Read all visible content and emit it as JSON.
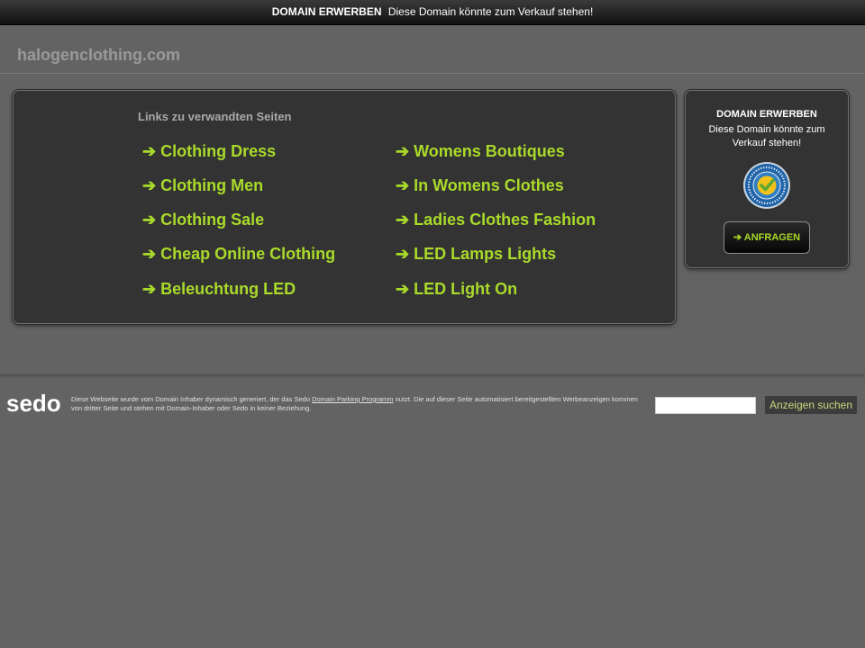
{
  "top_banner": {
    "strong": "DOMAIN ERWERBEN",
    "text": "Diese Domain könnte zum Verkauf stehen!"
  },
  "header": {
    "domain": "halogenclothing.com"
  },
  "links": {
    "heading": "Links zu verwandten Seiten",
    "arrow": "➔",
    "left": [
      "Clothing Dress",
      "Clothing Men",
      "Clothing Sale",
      "Cheap Online Clothing",
      "Beleuchtung LED"
    ],
    "right": [
      "Womens Boutiques",
      "In Womens Clothes",
      "Ladies Clothes Fashion",
      "LED Lamps Lights",
      "LED Light On"
    ]
  },
  "sidebar": {
    "title": "DOMAIN ERWERBEN",
    "text": "Diese Domain könnte zum Verkauf stehen!",
    "seal_text": "Sedo Buyer Protection · Safe & Secure",
    "button_label": "ANFRAGEN"
  },
  "footer": {
    "logo": "sedo",
    "text_before": "Diese Webseite wurde vom Domain Inhaber dynamisch generiert, der das Sedo",
    "link": "Domain Parking Programm",
    "text_after": "nutzt. Die auf dieser Seite automatisiert bereitgestellten Werbeanzeigen kommen von dritter Seite und stehen mit Domain-Inhaber oder Sedo in keiner Beziehung.",
    "search_placeholder": "",
    "search_button": "Anzeigen suchen"
  },
  "colors": {
    "background": "#636363",
    "panel": "#333333",
    "link_green": "#a9da2a",
    "seal_blue": "#1f63a8"
  }
}
